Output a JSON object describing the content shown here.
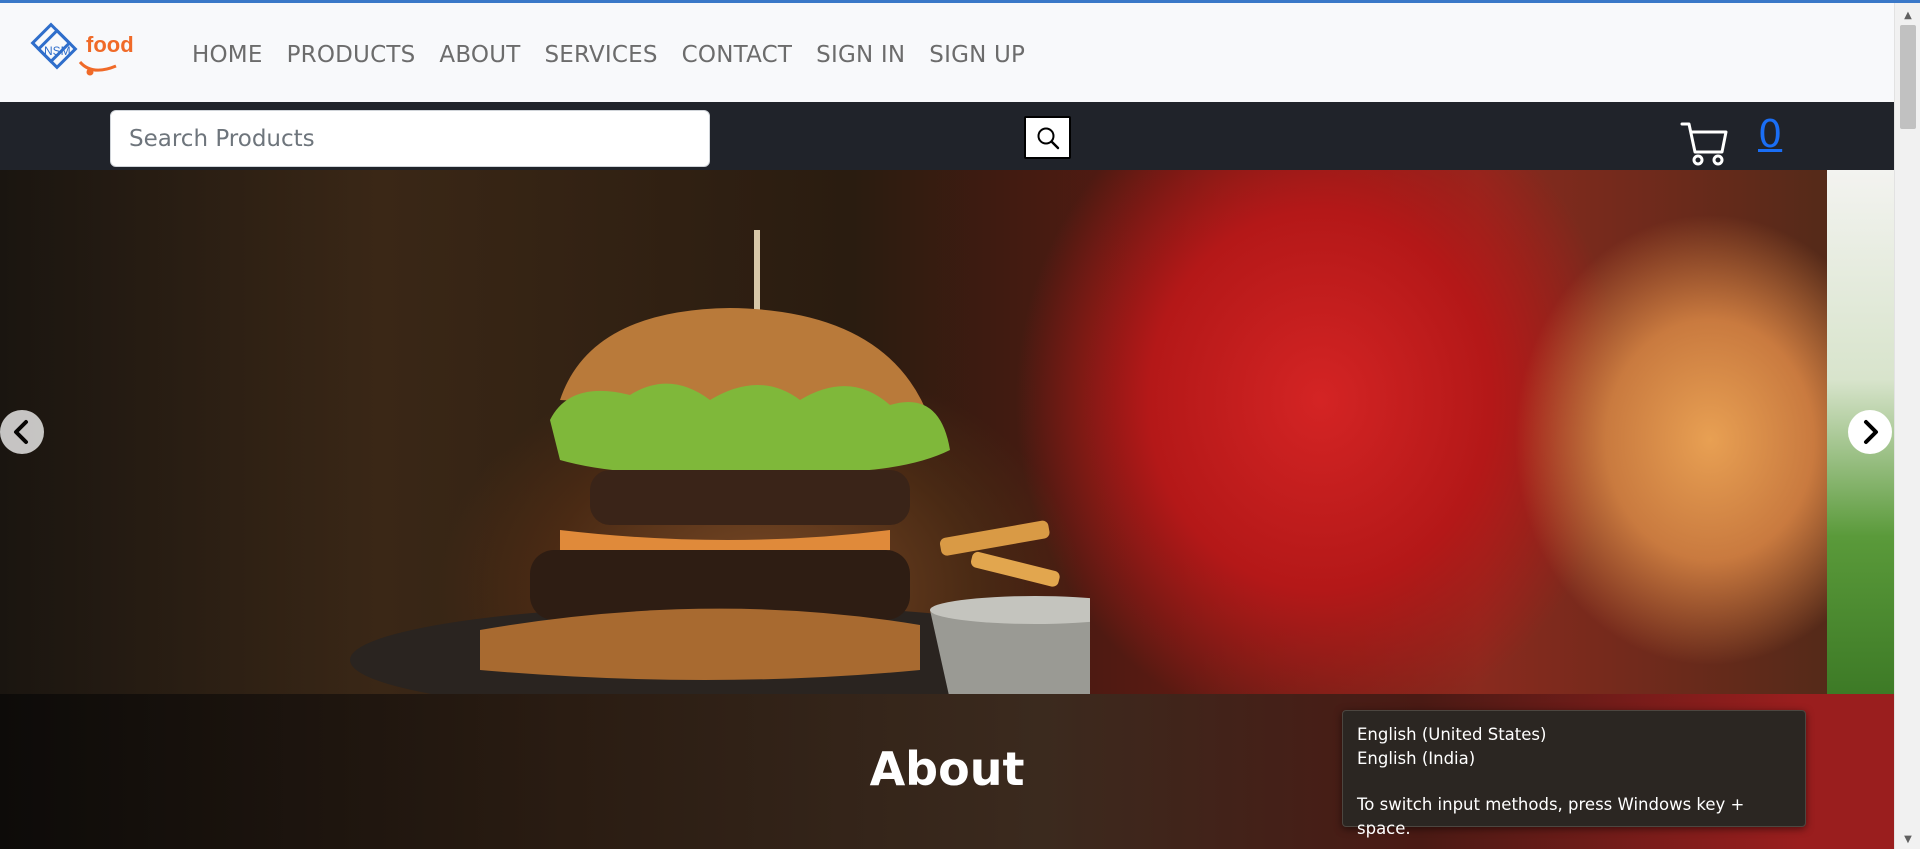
{
  "brand": {
    "logo_mark": "NSM",
    "logo_text": "food"
  },
  "nav": [
    {
      "label": "HOME"
    },
    {
      "label": "PRODUCTS"
    },
    {
      "label": "ABOUT"
    },
    {
      "label": "SERVICES"
    },
    {
      "label": "CONTACT"
    },
    {
      "label": "SIGN IN"
    },
    {
      "label": "SIGN UP"
    }
  ],
  "search": {
    "placeholder": "Search Products",
    "value": "",
    "button_icon": "search-icon"
  },
  "cart": {
    "icon": "cart-icon",
    "count": "0"
  },
  "carousel": {
    "prev_icon": "chevron-left-icon",
    "next_icon": "chevron-right-icon"
  },
  "about": {
    "title": "About"
  },
  "ime_tooltip": {
    "options": [
      "English (United States)",
      "English (India)"
    ],
    "hint": "To switch input methods, press Windows key + space."
  },
  "colors": {
    "accent": "#1a6ef5",
    "header_bg": "#f8f9fb",
    "searchbar_bg": "#20232a",
    "logo_blue": "#2f6ecb",
    "logo_orange": "#f06a28"
  }
}
